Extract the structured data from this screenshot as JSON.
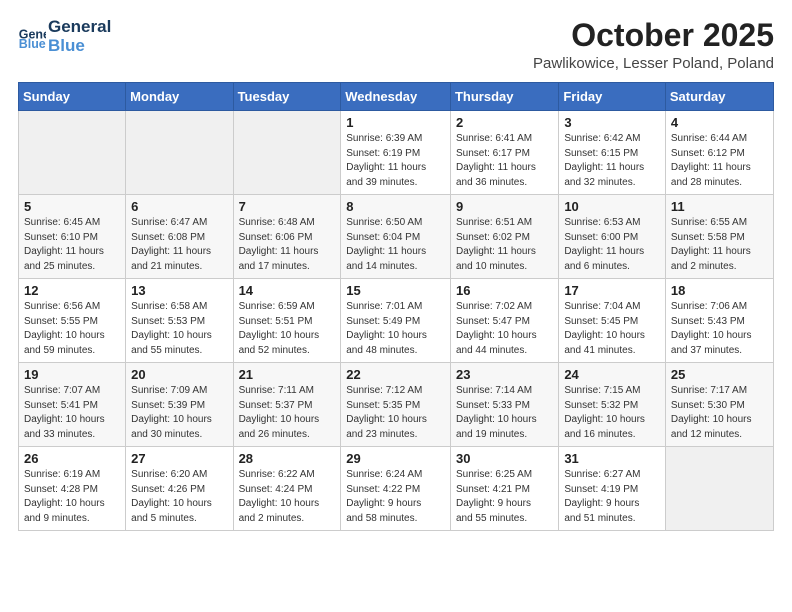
{
  "logo": {
    "line1": "General",
    "line2": "Blue"
  },
  "title": "October 2025",
  "subtitle": "Pawlikowice, Lesser Poland, Poland",
  "weekdays": [
    "Sunday",
    "Monday",
    "Tuesday",
    "Wednesday",
    "Thursday",
    "Friday",
    "Saturday"
  ],
  "weeks": [
    [
      {
        "day": "",
        "info": ""
      },
      {
        "day": "",
        "info": ""
      },
      {
        "day": "",
        "info": ""
      },
      {
        "day": "1",
        "info": "Sunrise: 6:39 AM\nSunset: 6:19 PM\nDaylight: 11 hours\nand 39 minutes."
      },
      {
        "day": "2",
        "info": "Sunrise: 6:41 AM\nSunset: 6:17 PM\nDaylight: 11 hours\nand 36 minutes."
      },
      {
        "day": "3",
        "info": "Sunrise: 6:42 AM\nSunset: 6:15 PM\nDaylight: 11 hours\nand 32 minutes."
      },
      {
        "day": "4",
        "info": "Sunrise: 6:44 AM\nSunset: 6:12 PM\nDaylight: 11 hours\nand 28 minutes."
      }
    ],
    [
      {
        "day": "5",
        "info": "Sunrise: 6:45 AM\nSunset: 6:10 PM\nDaylight: 11 hours\nand 25 minutes."
      },
      {
        "day": "6",
        "info": "Sunrise: 6:47 AM\nSunset: 6:08 PM\nDaylight: 11 hours\nand 21 minutes."
      },
      {
        "day": "7",
        "info": "Sunrise: 6:48 AM\nSunset: 6:06 PM\nDaylight: 11 hours\nand 17 minutes."
      },
      {
        "day": "8",
        "info": "Sunrise: 6:50 AM\nSunset: 6:04 PM\nDaylight: 11 hours\nand 14 minutes."
      },
      {
        "day": "9",
        "info": "Sunrise: 6:51 AM\nSunset: 6:02 PM\nDaylight: 11 hours\nand 10 minutes."
      },
      {
        "day": "10",
        "info": "Sunrise: 6:53 AM\nSunset: 6:00 PM\nDaylight: 11 hours\nand 6 minutes."
      },
      {
        "day": "11",
        "info": "Sunrise: 6:55 AM\nSunset: 5:58 PM\nDaylight: 11 hours\nand 2 minutes."
      }
    ],
    [
      {
        "day": "12",
        "info": "Sunrise: 6:56 AM\nSunset: 5:55 PM\nDaylight: 10 hours\nand 59 minutes."
      },
      {
        "day": "13",
        "info": "Sunrise: 6:58 AM\nSunset: 5:53 PM\nDaylight: 10 hours\nand 55 minutes."
      },
      {
        "day": "14",
        "info": "Sunrise: 6:59 AM\nSunset: 5:51 PM\nDaylight: 10 hours\nand 52 minutes."
      },
      {
        "day": "15",
        "info": "Sunrise: 7:01 AM\nSunset: 5:49 PM\nDaylight: 10 hours\nand 48 minutes."
      },
      {
        "day": "16",
        "info": "Sunrise: 7:02 AM\nSunset: 5:47 PM\nDaylight: 10 hours\nand 44 minutes."
      },
      {
        "day": "17",
        "info": "Sunrise: 7:04 AM\nSunset: 5:45 PM\nDaylight: 10 hours\nand 41 minutes."
      },
      {
        "day": "18",
        "info": "Sunrise: 7:06 AM\nSunset: 5:43 PM\nDaylight: 10 hours\nand 37 minutes."
      }
    ],
    [
      {
        "day": "19",
        "info": "Sunrise: 7:07 AM\nSunset: 5:41 PM\nDaylight: 10 hours\nand 33 minutes."
      },
      {
        "day": "20",
        "info": "Sunrise: 7:09 AM\nSunset: 5:39 PM\nDaylight: 10 hours\nand 30 minutes."
      },
      {
        "day": "21",
        "info": "Sunrise: 7:11 AM\nSunset: 5:37 PM\nDaylight: 10 hours\nand 26 minutes."
      },
      {
        "day": "22",
        "info": "Sunrise: 7:12 AM\nSunset: 5:35 PM\nDaylight: 10 hours\nand 23 minutes."
      },
      {
        "day": "23",
        "info": "Sunrise: 7:14 AM\nSunset: 5:33 PM\nDaylight: 10 hours\nand 19 minutes."
      },
      {
        "day": "24",
        "info": "Sunrise: 7:15 AM\nSunset: 5:32 PM\nDaylight: 10 hours\nand 16 minutes."
      },
      {
        "day": "25",
        "info": "Sunrise: 7:17 AM\nSunset: 5:30 PM\nDaylight: 10 hours\nand 12 minutes."
      }
    ],
    [
      {
        "day": "26",
        "info": "Sunrise: 6:19 AM\nSunset: 4:28 PM\nDaylight: 10 hours\nand 9 minutes."
      },
      {
        "day": "27",
        "info": "Sunrise: 6:20 AM\nSunset: 4:26 PM\nDaylight: 10 hours\nand 5 minutes."
      },
      {
        "day": "28",
        "info": "Sunrise: 6:22 AM\nSunset: 4:24 PM\nDaylight: 10 hours\nand 2 minutes."
      },
      {
        "day": "29",
        "info": "Sunrise: 6:24 AM\nSunset: 4:22 PM\nDaylight: 9 hours\nand 58 minutes."
      },
      {
        "day": "30",
        "info": "Sunrise: 6:25 AM\nSunset: 4:21 PM\nDaylight: 9 hours\nand 55 minutes."
      },
      {
        "day": "31",
        "info": "Sunrise: 6:27 AM\nSunset: 4:19 PM\nDaylight: 9 hours\nand 51 minutes."
      },
      {
        "day": "",
        "info": ""
      }
    ]
  ]
}
